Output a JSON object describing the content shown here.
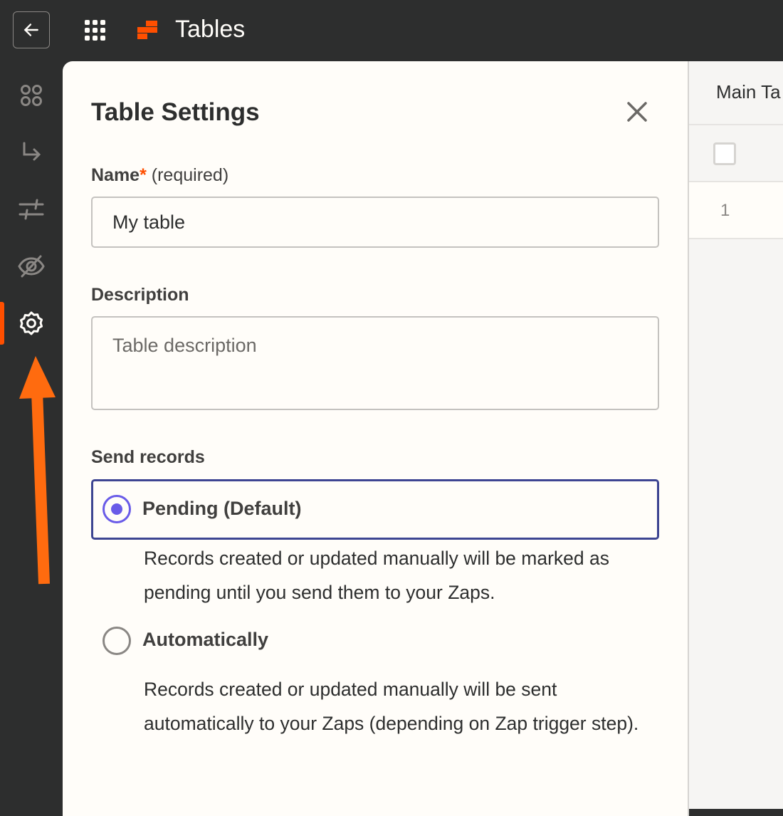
{
  "topbar": {
    "app_title": "Tables",
    "back_icon": "arrow-left-icon",
    "apps_icon": "grid-icon",
    "brand_color": "#ff4f00"
  },
  "sidebar": {
    "items": [
      {
        "icon": "nodes-icon"
      },
      {
        "icon": "arrow-turn-icon"
      },
      {
        "icon": "sliders-icon"
      },
      {
        "icon": "eye-off-icon"
      },
      {
        "icon": "gear-icon",
        "active": true
      }
    ]
  },
  "panel": {
    "title": "Table Settings",
    "name_label": "Name",
    "name_required_star": "*",
    "name_required_text": "(required)",
    "name_value": "My table",
    "description_label": "Description",
    "description_placeholder": "Table description",
    "send_records_label": "Send records",
    "options": [
      {
        "label": "Pending (Default)",
        "selected": true,
        "description": "Records created or updated manually will be marked as pending until you send them to your Zaps."
      },
      {
        "label": "Automatically",
        "selected": false,
        "description": "Records created or updated manually will be sent automatically to your Zaps (depending on Zap trigger step)."
      }
    ],
    "accent_color": "#695be8"
  },
  "table": {
    "tab_label": "Main Ta",
    "rows": [
      {
        "number": "1"
      }
    ]
  },
  "annotation": {
    "arrow_color": "#ff6b0f"
  }
}
